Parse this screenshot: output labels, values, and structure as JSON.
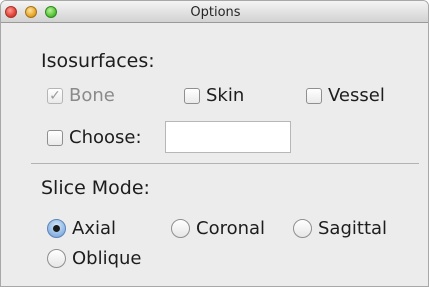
{
  "window": {
    "title": "Options"
  },
  "isosurfaces": {
    "label": "Isosurfaces:",
    "bone": {
      "label": "Bone",
      "checked": true,
      "enabled": false
    },
    "skin": {
      "label": "Skin",
      "checked": false
    },
    "vessel": {
      "label": "Vessel",
      "checked": false
    },
    "choose": {
      "label": "Choose:",
      "checked": false,
      "value": ""
    }
  },
  "slice_mode": {
    "label": "Slice Mode:",
    "options": [
      {
        "label": "Axial",
        "selected": true
      },
      {
        "label": "Coronal",
        "selected": false
      },
      {
        "label": "Sagittal",
        "selected": false
      },
      {
        "label": "Oblique",
        "selected": false
      }
    ]
  },
  "colors": {
    "window_bg": "#ececec",
    "selected_radio": "#88b3e2"
  }
}
